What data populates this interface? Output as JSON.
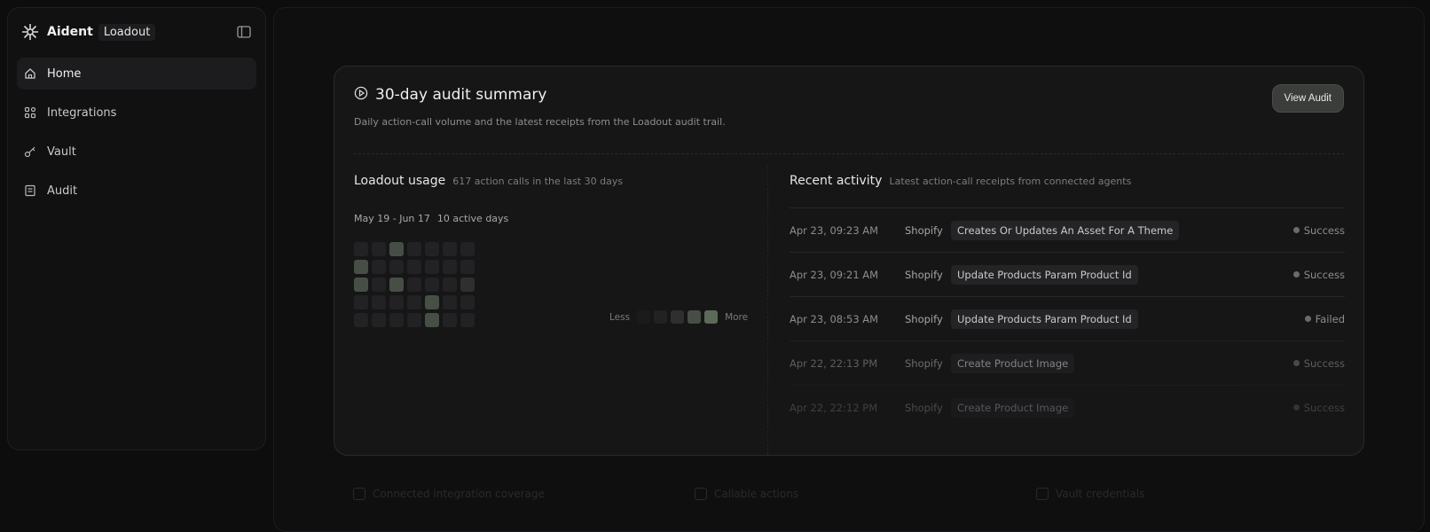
{
  "brand": {
    "name": "Aident",
    "tag": "Loadout"
  },
  "nav": [
    {
      "label": "Home",
      "icon": "home-icon",
      "active": true
    },
    {
      "label": "Integrations",
      "icon": "grid-icon",
      "active": false
    },
    {
      "label": "Vault",
      "icon": "key-icon",
      "active": false
    },
    {
      "label": "Audit",
      "icon": "list-icon",
      "active": false
    }
  ],
  "summary": {
    "title": "30-day audit summary",
    "subtitle": "Daily action-call volume and the latest receipts from the Loadout audit trail.",
    "view_button": "View Audit"
  },
  "usage": {
    "title": "Loadout usage",
    "meta": "617 action calls in the last 30 days",
    "range": "May 19 - Jun 17",
    "active_days": "10 active days",
    "heatmap_levels": [
      [
        1,
        1,
        3,
        1,
        1,
        1,
        1
      ],
      [
        3,
        1,
        1,
        1,
        1,
        1,
        1
      ],
      [
        3,
        1,
        3,
        1,
        1,
        1,
        2
      ],
      [
        1,
        1,
        1,
        1,
        3,
        1,
        1
      ],
      [
        1,
        1,
        1,
        1,
        3,
        1,
        1
      ]
    ],
    "legend_less": "Less",
    "legend_more": "More",
    "level_colors": [
      "#18181a",
      "#222224",
      "#2e302e",
      "#474e46",
      "#5b6b58"
    ]
  },
  "activity": {
    "title": "Recent activity",
    "meta": "Latest action-call receipts from connected agents",
    "rows": [
      {
        "time": "Apr 23, 09:23 AM",
        "app": "Shopify",
        "action": "Creates Or Updates An Asset For A Theme",
        "status": "Success"
      },
      {
        "time": "Apr 23, 09:21 AM",
        "app": "Shopify",
        "action": "Update Products Param Product Id",
        "status": "Success"
      },
      {
        "time": "Apr 23, 08:53 AM",
        "app": "Shopify",
        "action": "Update Products Param Product Id",
        "status": "Failed"
      },
      {
        "time": "Apr 22, 22:13 PM",
        "app": "Shopify",
        "action": "Create Product Image",
        "status": "Success"
      },
      {
        "time": "Apr 22, 22:12 PM",
        "app": "Shopify",
        "action": "Create Product Image",
        "status": "Success"
      }
    ]
  },
  "footer": [
    "Connected integration coverage",
    "Callable actions",
    "Vault credentials"
  ]
}
